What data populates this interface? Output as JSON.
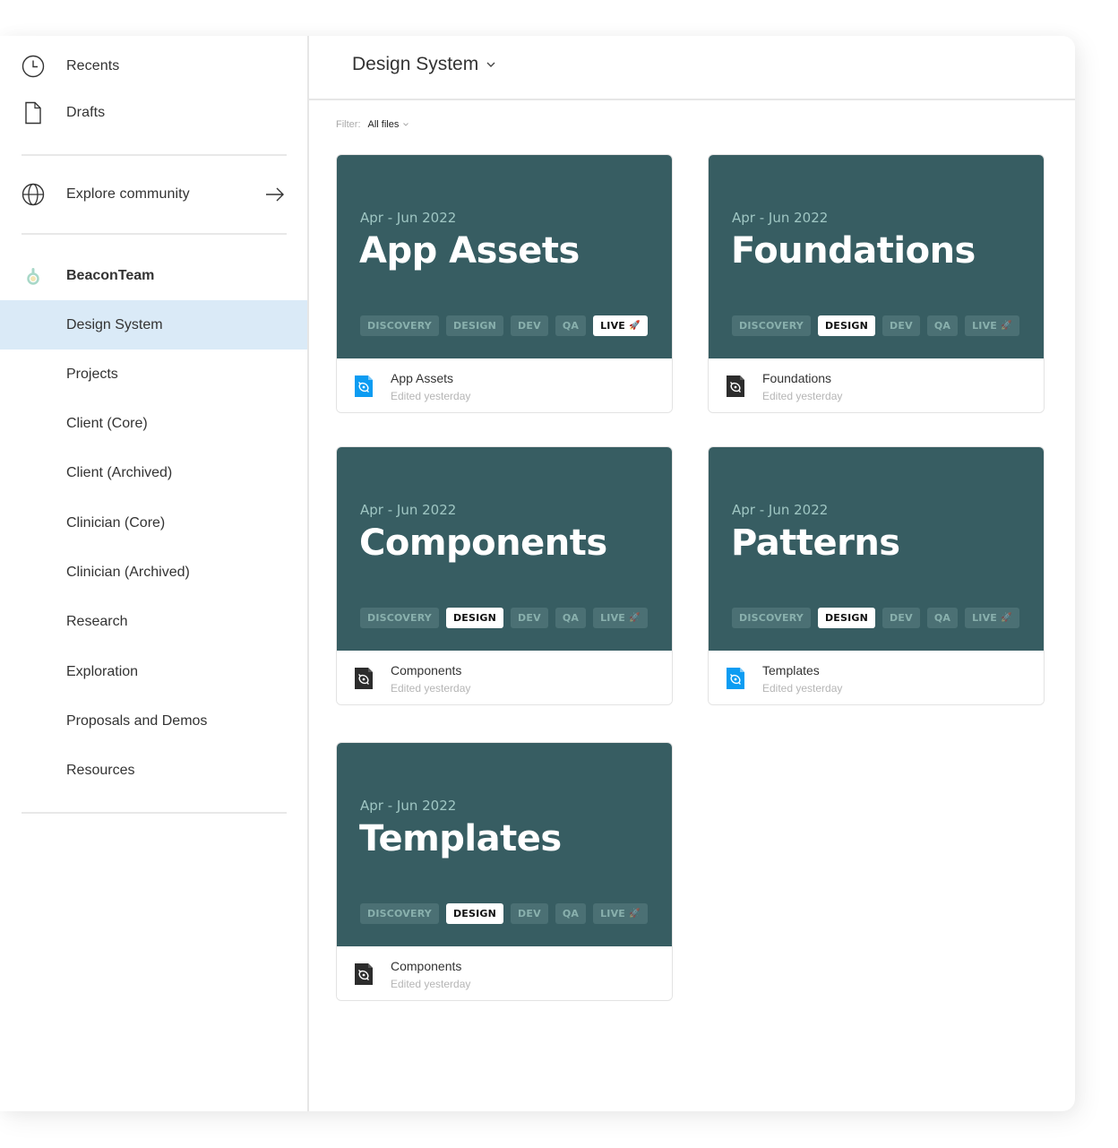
{
  "sidebar": {
    "recents_label": "Recents",
    "drafts_label": "Drafts",
    "explore_label": "Explore community",
    "team_name": "BeaconTeam",
    "projects": [
      {
        "label": "Design System",
        "active": true
      },
      {
        "label": "Projects"
      },
      {
        "label": "Client (Core)"
      },
      {
        "label": "Client (Archived)"
      },
      {
        "label": "Clinician (Core)"
      },
      {
        "label": "Clinician (Archived)"
      },
      {
        "label": "Research"
      },
      {
        "label": "Exploration"
      },
      {
        "label": "Proposals and Demos"
      },
      {
        "label": "Resources"
      }
    ]
  },
  "header": {
    "title": "Design System"
  },
  "filter": {
    "label": "Filter:",
    "value": "All files"
  },
  "colors": {
    "thumbnail_bg": "#375d62",
    "active_nav_bg": "#daeaf7",
    "file_icon_blue": "#0c9cf2",
    "file_icon_dark": "#2c2c2c"
  },
  "cards": [
    {
      "date": "Apr - Jun 2022",
      "title": "App Assets",
      "tags": [
        "DISCOVERY",
        "DESIGN",
        "DEV",
        "QA",
        "LIVE"
      ],
      "active_tag": "LIVE",
      "file_name": "App Assets",
      "file_meta": "Edited yesterday",
      "file_icon": "blue"
    },
    {
      "date": "Apr - Jun 2022",
      "title": "Foundations",
      "tags": [
        "DISCOVERY",
        "DESIGN",
        "DEV",
        "QA",
        "LIVE"
      ],
      "active_tag": "DESIGN",
      "file_name": "Foundations",
      "file_meta": "Edited yesterday",
      "file_icon": "dark"
    },
    {
      "date": "Apr - Jun 2022",
      "title": "Components",
      "tags": [
        "DISCOVERY",
        "DESIGN",
        "DEV",
        "QA",
        "LIVE"
      ],
      "active_tag": "DESIGN",
      "file_name": "Components",
      "file_meta": "Edited yesterday",
      "file_icon": "dark"
    },
    {
      "date": "Apr - Jun 2022",
      "title": "Patterns",
      "tags": [
        "DISCOVERY",
        "DESIGN",
        "DEV",
        "QA",
        "LIVE"
      ],
      "active_tag": "DESIGN",
      "file_name": "Templates",
      "file_meta": "Edited yesterday",
      "file_icon": "blue"
    },
    {
      "date": "Apr - Jun 2022",
      "title": "Templates",
      "tags": [
        "DISCOVERY",
        "DESIGN",
        "DEV",
        "QA",
        "LIVE"
      ],
      "active_tag": "DESIGN",
      "file_name": "Components",
      "file_meta": "Edited yesterday",
      "file_icon": "dark"
    }
  ]
}
